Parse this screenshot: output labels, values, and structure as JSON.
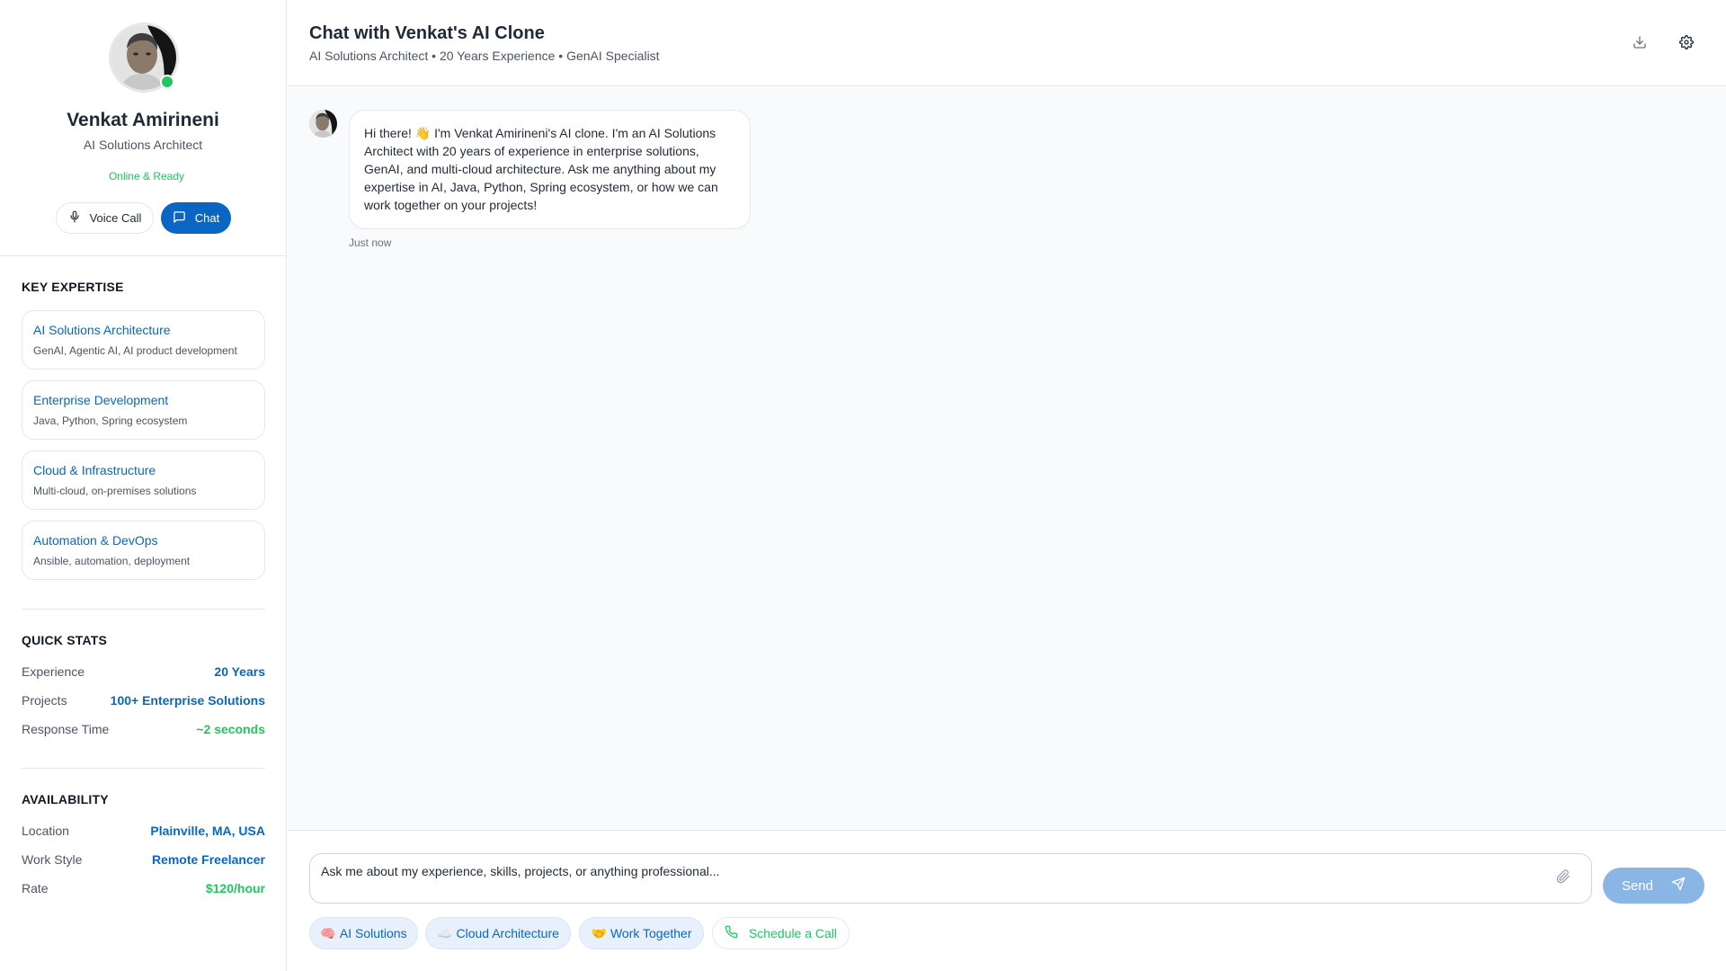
{
  "profile": {
    "name": "Venkat Amirineni",
    "role": "AI Solutions Architect",
    "status": "Online & Ready",
    "voice_call_label": "Voice Call",
    "chat_label": "Chat"
  },
  "expertise": {
    "title": "KEY EXPERTISE",
    "items": [
      {
        "title": "AI Solutions Architecture",
        "desc": "GenAI, Agentic AI, AI product development"
      },
      {
        "title": "Enterprise Development",
        "desc": "Java, Python, Spring ecosystem"
      },
      {
        "title": "Cloud & Infrastructure",
        "desc": "Multi-cloud, on-premises solutions"
      },
      {
        "title": "Automation & DevOps",
        "desc": "Ansible, automation, deployment"
      }
    ]
  },
  "quick_stats": {
    "title": "QUICK STATS",
    "rows": [
      {
        "label": "Experience",
        "value": "20 Years"
      },
      {
        "label": "Projects",
        "value": "100+ Enterprise Solutions"
      },
      {
        "label": "Response Time",
        "value": "~2 seconds"
      }
    ]
  },
  "availability": {
    "title": "AVAILABILITY",
    "rows": [
      {
        "label": "Location",
        "value": "Plainville, MA, USA"
      },
      {
        "label": "Work Style",
        "value": "Remote Freelancer"
      },
      {
        "label": "Rate",
        "value": "$120/hour"
      }
    ]
  },
  "header": {
    "title": "Chat with Venkat's AI Clone",
    "subtitle": "AI Solutions Architect • 20 Years Experience • GenAI Specialist"
  },
  "messages": [
    {
      "text": "Hi there! 👋 I'm Venkat Amirineni's AI clone. I'm an AI Solutions Architect with 20 years of experience in enterprise solutions, GenAI, and multi-cloud architecture. Ask me anything about my expertise in AI, Java, Python, Spring ecosystem, or how we can work together on your projects!",
      "time": "Just now"
    }
  ],
  "composer": {
    "placeholder": "Ask me about my experience, skills, projects, or anything professional...",
    "send_label": "Send"
  },
  "quick_replies": [
    {
      "emoji": "🧠",
      "label": "AI Solutions"
    },
    {
      "emoji": "☁️",
      "label": "Cloud Architecture"
    },
    {
      "emoji": "🤝",
      "label": "Work Together"
    },
    {
      "label": "Schedule a Call"
    }
  ],
  "colors": {
    "accent": "#0a66c2",
    "success": "#22c55e",
    "send_disabled": "#8ab6e6"
  }
}
